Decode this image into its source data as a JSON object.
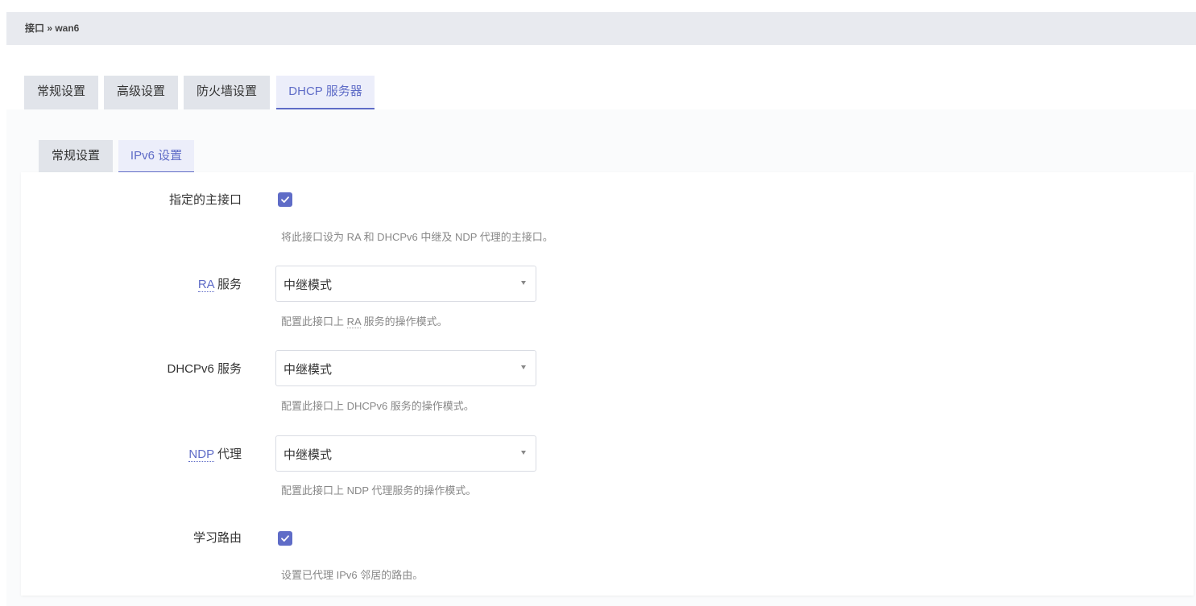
{
  "breadcrumb": "接口 » wan6",
  "main_tabs": [
    {
      "label": "常规设置",
      "active": false
    },
    {
      "label": "高级设置",
      "active": false
    },
    {
      "label": "防火墙设置",
      "active": false
    },
    {
      "label": "DHCP 服务器",
      "active": true
    }
  ],
  "sub_tabs": [
    {
      "label": "常规设置",
      "active": false
    },
    {
      "label": "IPv6 设置",
      "active": true
    }
  ],
  "fields": {
    "master": {
      "label": "指定的主接口",
      "checked": true,
      "help": "将此接口设为 RA 和 DHCPv6 中继及 NDP 代理的主接口。"
    },
    "ra": {
      "label_abbr": "RA",
      "label_rest": " 服务",
      "value": "中继模式",
      "help_pre": "配置此接口上 ",
      "help_abbr": "RA",
      "help_post": " 服务的操作模式。"
    },
    "dhcpv6": {
      "label": "DHCPv6 服务",
      "value": "中继模式",
      "help": "配置此接口上 DHCPv6 服务的操作模式。"
    },
    "ndp": {
      "label_abbr": "NDP",
      "label_rest": " 代理",
      "value": "中继模式",
      "help": "配置此接口上 NDP 代理服务的操作模式。"
    },
    "learn_routes": {
      "label": "学习路由",
      "checked": true,
      "help": "设置已代理 IPv6 邻居的路由。"
    }
  },
  "colors": {
    "accent": "#5f6cc7",
    "tab_bg": "#e1e4ea",
    "breadcrumb_bg": "#e8eaef"
  }
}
